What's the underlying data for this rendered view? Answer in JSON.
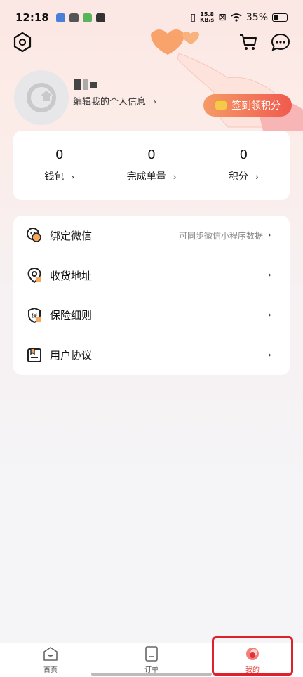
{
  "status_bar": {
    "time": "12:18",
    "net_speed_value": "15.8",
    "net_speed_unit": "KB/s",
    "battery": "35%"
  },
  "profile": {
    "edit_label": "编辑我的个人信息",
    "checkin_label": "签到领积分"
  },
  "stats": [
    {
      "value": "0",
      "label": "钱包"
    },
    {
      "value": "0",
      "label": "完成单量"
    },
    {
      "value": "0",
      "label": "积分"
    }
  ],
  "menu": [
    {
      "label": "绑定微信",
      "sub": "可同步微信小程序数据",
      "icon": "wechat-icon"
    },
    {
      "label": "收货地址",
      "sub": "",
      "icon": "location-icon"
    },
    {
      "label": "保险细则",
      "sub": "",
      "icon": "insurance-icon"
    },
    {
      "label": "用户协议",
      "sub": "",
      "icon": "agreement-icon"
    }
  ],
  "tabs": [
    {
      "label": "首页",
      "icon": "home-icon"
    },
    {
      "label": "订单",
      "icon": "order-icon"
    },
    {
      "label": "我的",
      "icon": "profile-icon"
    }
  ],
  "colors": {
    "accent": "#f05a4e",
    "highlight_box": "#e0202a"
  }
}
